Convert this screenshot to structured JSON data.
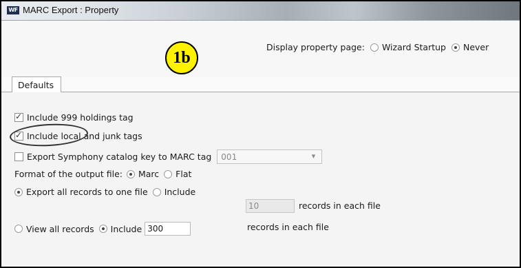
{
  "window": {
    "app_icon_text": "WF",
    "title": "MARC Export : Property"
  },
  "display_property_page": {
    "label": "Display property page:",
    "options": [
      {
        "label": "Wizard Startup",
        "selected": false
      },
      {
        "label": "Never",
        "selected": true
      }
    ]
  },
  "annotation": {
    "badge_text": "1b"
  },
  "tabs": [
    {
      "label": "Defaults",
      "active": true
    }
  ],
  "defaults": {
    "include_999": {
      "label": "Include 999 holdings tag",
      "checked": true
    },
    "include_local": {
      "label": "Include local and junk tags",
      "checked": true
    },
    "export_catkey": {
      "label": "Export Symphony catalog key to MARC tag",
      "checked": false,
      "tag_value": "001"
    },
    "format": {
      "label": "Format of the output file:",
      "options": [
        {
          "label": "Marc",
          "selected": true
        },
        {
          "label": "Flat",
          "selected": false
        }
      ]
    },
    "export_records": {
      "option_all": "Export all records to one file",
      "option_all_selected": true,
      "option_include": "Include",
      "option_include_selected": false,
      "count_value": "10",
      "suffix": "records in each file"
    },
    "view_records": {
      "option_all": "View all records",
      "option_all_selected": false,
      "option_include": "Include",
      "option_include_selected": true,
      "count_value": "300",
      "suffix": "records in each file"
    }
  },
  "colors": {
    "badge": "#fff200",
    "panel_bg": "#f4f4f4"
  }
}
